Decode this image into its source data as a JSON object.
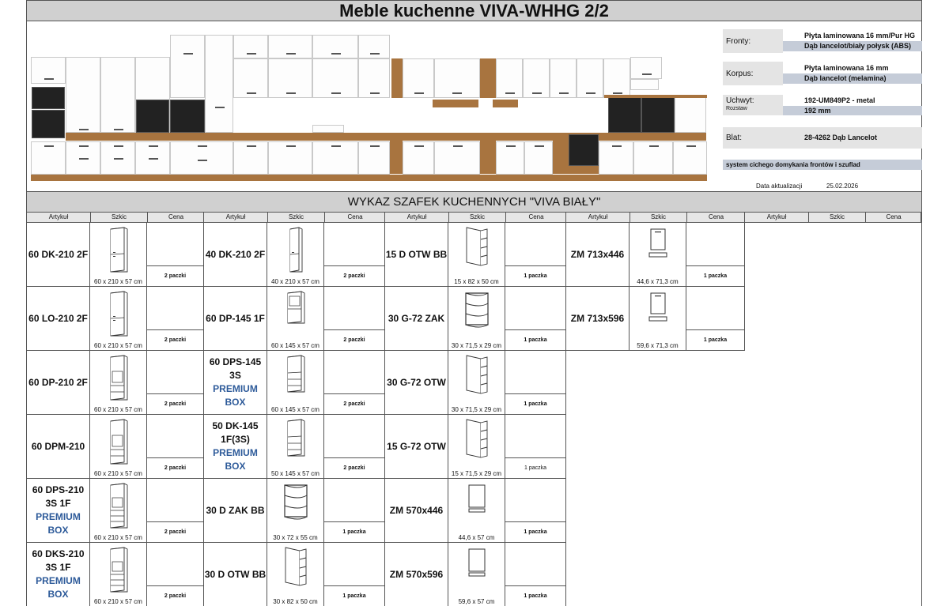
{
  "header": {
    "title": "Meble kuchenne VIVA-WHHG 2/2"
  },
  "specs": {
    "fronty_label": "Fronty:",
    "fronty_val1": "Płyta laminowana 16 mm/Pur HG",
    "fronty_val2": "Dąb lancelot/biały połysk (ABS)",
    "korpus_label": "Korpus:",
    "korpus_val1": "Płyta laminowana 16 mm",
    "korpus_val2": "Dąb lancelot (melamina)",
    "uchwyt_label": "Uchwyt:",
    "uchwyt_val": "192-UM849P2 - metal",
    "rozstaw_label": "Rozstaw",
    "rozstaw_val": "192 mm",
    "blat_label": "Blat:",
    "blat_val": "28-4262 Dąb Lancelot",
    "system": "system cichego domykania frontów i szuflad",
    "update_label": "Data aktualizacji",
    "update_val": "25.02.2026"
  },
  "list": {
    "title": "WYKAZ SZAFEK KUCHENNYCH \"VIVA BIAŁY\"",
    "col_artykul": "Artykuł",
    "col_szkic": "Szkic",
    "col_cena": "Cena"
  },
  "items": [
    [
      {
        "name": [
          "60 DK-210 2F"
        ],
        "dim": "60 x 210 x 57 cm",
        "pack": "2 paczki",
        "icon": "tall-cabinet-icon"
      },
      {
        "name": [
          "60 LO-210 2F"
        ],
        "dim": "60 x 210 x 57 cm",
        "pack": "2 paczki",
        "icon": "tall-cabinet-icon"
      },
      {
        "name": [
          "60 DP-210 2F"
        ],
        "dim": "60 x 210 x 57 cm",
        "pack": "2 paczki",
        "icon": "tall-oven-cabinet-icon"
      },
      {
        "name": [
          "60 DPM-210"
        ],
        "dim": "60 x 210 x 57 cm",
        "pack": "2 paczki",
        "icon": "tall-oven-cabinet-icon"
      },
      {
        "name": [
          "60 DPS-210",
          "3S 1F"
        ],
        "premium": [
          "PREMIUM",
          "BOX"
        ],
        "dim": "60 x 210 x 57 cm",
        "pack": "2 paczki",
        "icon": "tall-drawer-cabinet-icon"
      },
      {
        "name": [
          "60 DKS-210",
          "3S 1F"
        ],
        "premium": [
          "PREMIUM",
          "BOX"
        ],
        "dim": "60 x 210 x 57 cm",
        "pack": "2 paczki",
        "icon": "tall-drawer-cabinet-icon"
      }
    ],
    [
      {
        "name": [
          "40 DK-210 2F"
        ],
        "dim": "40 x 210 x 57 cm",
        "pack": "2 paczki",
        "icon": "narrow-tall-cabinet-icon"
      },
      {
        "name": [
          "60 DP-145 1F"
        ],
        "dim": "60 x 145 x 57 cm",
        "pack": "2 paczki",
        "icon": "oven-cabinet-icon"
      },
      {
        "name": [
          "60 DPS-145 3S"
        ],
        "premium": [
          "PREMIUM",
          "BOX"
        ],
        "dim": "60 x 145 x 57 cm",
        "pack": "2 paczki",
        "icon": "drawer-cabinet-icon"
      },
      {
        "name": [
          "50 DK-145",
          "1F(3S)"
        ],
        "premium": [
          "PREMIUM",
          "BOX"
        ],
        "dim": "50 x 145 x 57 cm",
        "pack": "2 paczki",
        "icon": "drawer-cabinet-icon"
      },
      {
        "name": [
          "30 D ZAK BB"
        ],
        "dim": "30 x 72 x 55 cm",
        "pack": "1 paczka",
        "icon": "corner-shelf-icon"
      },
      {
        "name": [
          "30 D OTW BB"
        ],
        "dim": "30 x 82 x 50 cm",
        "pack": "1 paczka",
        "icon": "open-shelf-icon"
      }
    ],
    [
      {
        "name": [
          "15 D OTW BB"
        ],
        "dim": "15 x 82 x 50 cm",
        "pack": "1 paczka",
        "icon": "open-shelf-icon"
      },
      {
        "name": [
          "30 G-72 ZAK"
        ],
        "dim": "30 x 71,5 x 29 cm",
        "pack": "1 paczka",
        "icon": "corner-shelf-icon"
      },
      {
        "name": [
          "30 G-72 OTW"
        ],
        "dim": "30 x 71,5 x 29 cm",
        "pack": "1 paczka",
        "icon": "open-shelf-icon"
      },
      {
        "name": [
          "15 G-72 OTW"
        ],
        "dim": "15 x 71,5 x 29 cm",
        "pack": "1 paczka",
        "light": true,
        "icon": "open-shelf-icon"
      },
      {
        "name": [
          "ZM 570x446"
        ],
        "dim": "44,6 x 57 cm",
        "pack": "1 paczka",
        "icon": "panel-front-icon"
      },
      {
        "name": [
          "ZM 570x596"
        ],
        "dim": "59,6 x 57 cm",
        "pack": "1 paczka",
        "icon": "panel-front-icon"
      }
    ],
    [
      {
        "name": [
          "ZM 713x446"
        ],
        "dim": "44,6 x 71,3 cm",
        "pack": "1 paczka",
        "icon": "dishwasher-front-icon"
      },
      {
        "name": [
          "ZM 713x596"
        ],
        "dim": "59,6 x 71,3 cm",
        "pack": "1 paczka",
        "icon": "dishwasher-front-icon"
      }
    ]
  ]
}
